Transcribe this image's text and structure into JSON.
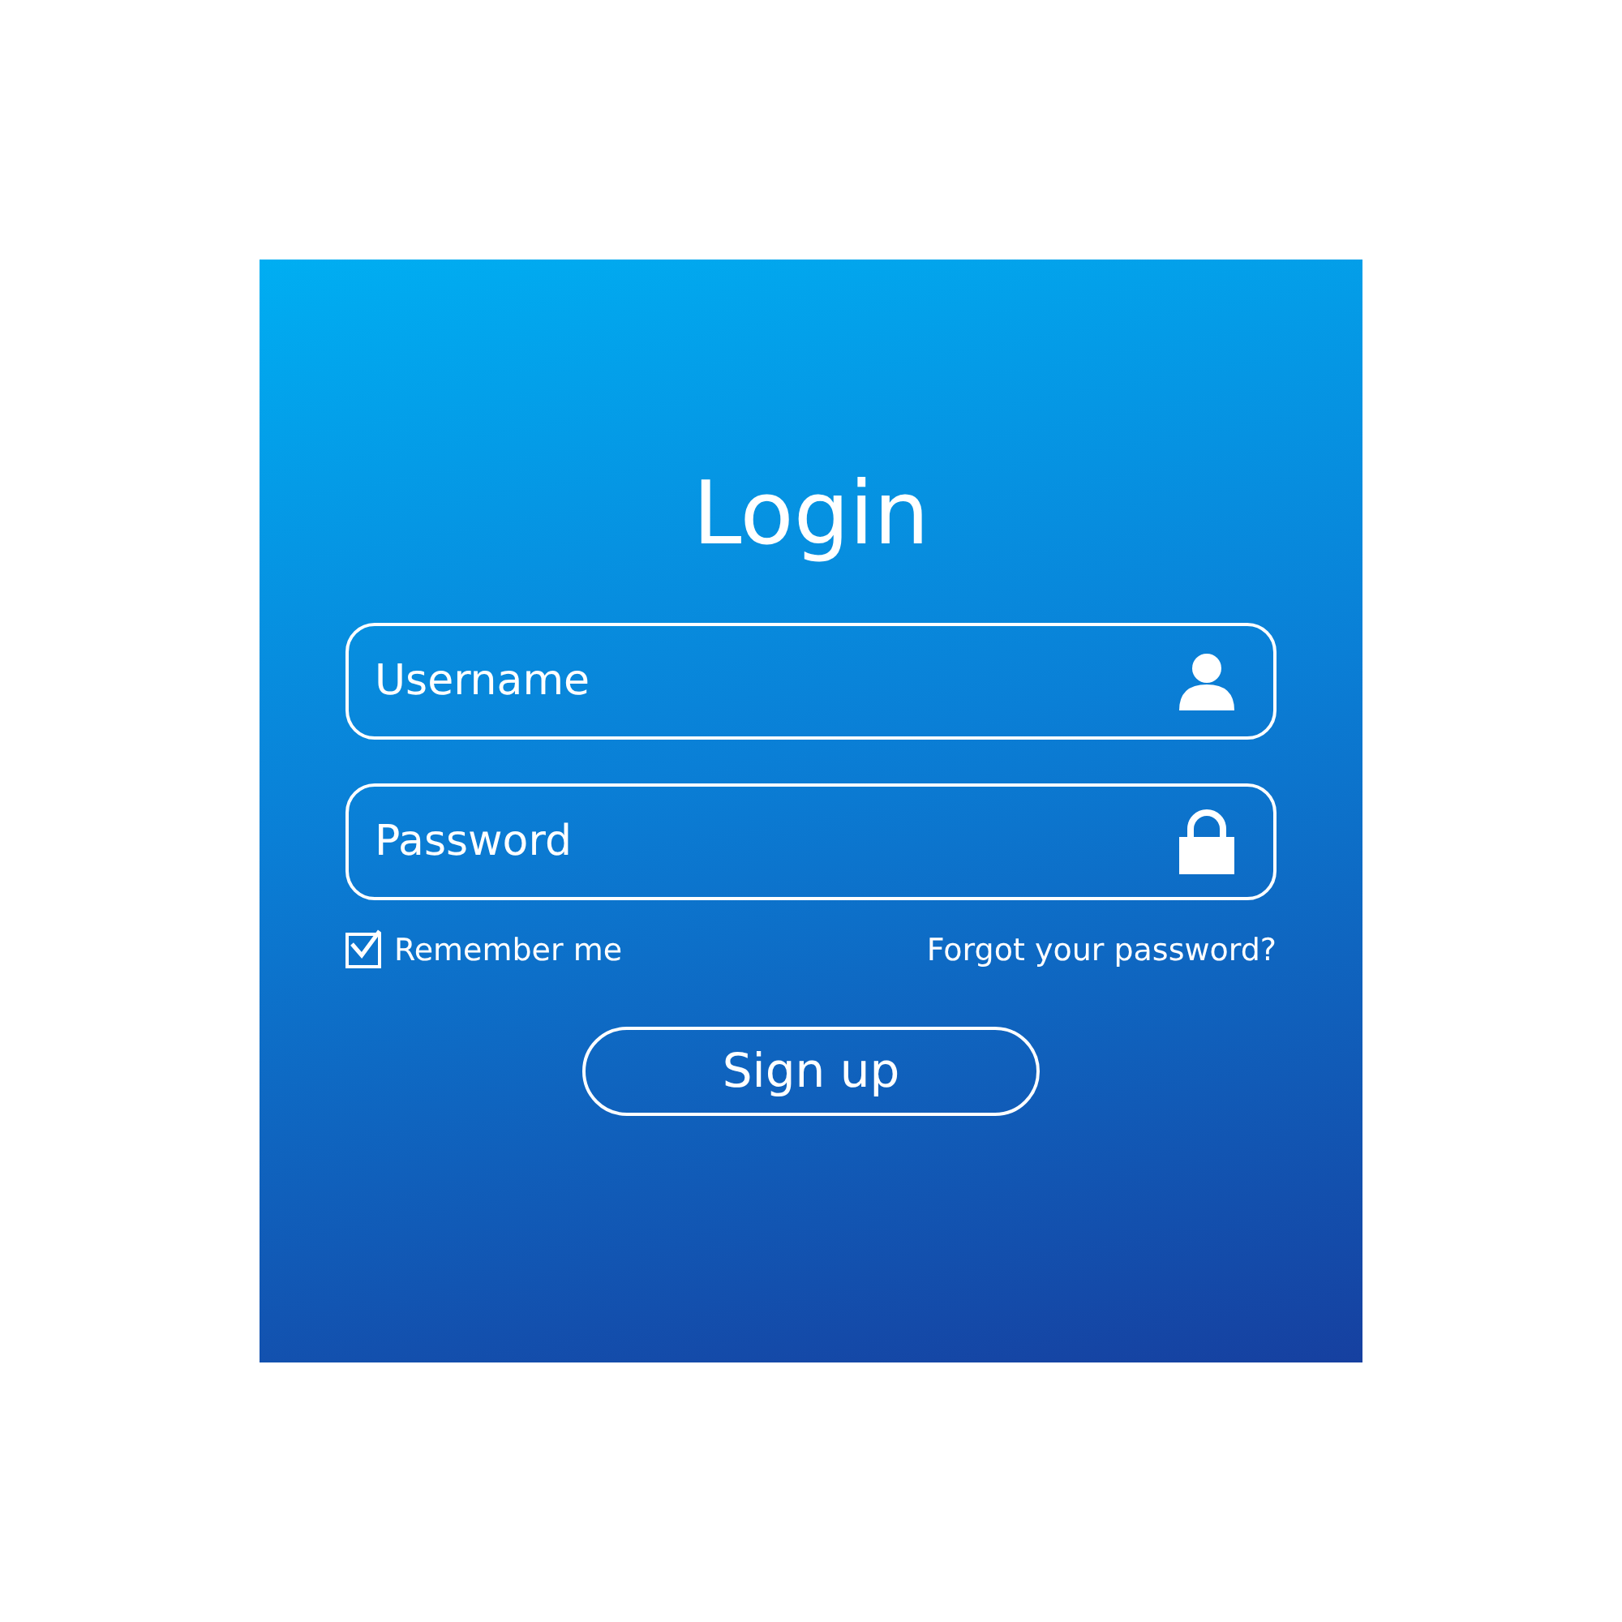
{
  "title": "Login",
  "fields": [
    {
      "kind": "user",
      "placeholder": "Username"
    },
    {
      "kind": "lock",
      "placeholder": "Password"
    }
  ],
  "remember": {
    "label": "Remember me",
    "checked": true
  },
  "forgot_link": "Forgot your password?",
  "button": "Sign up"
}
